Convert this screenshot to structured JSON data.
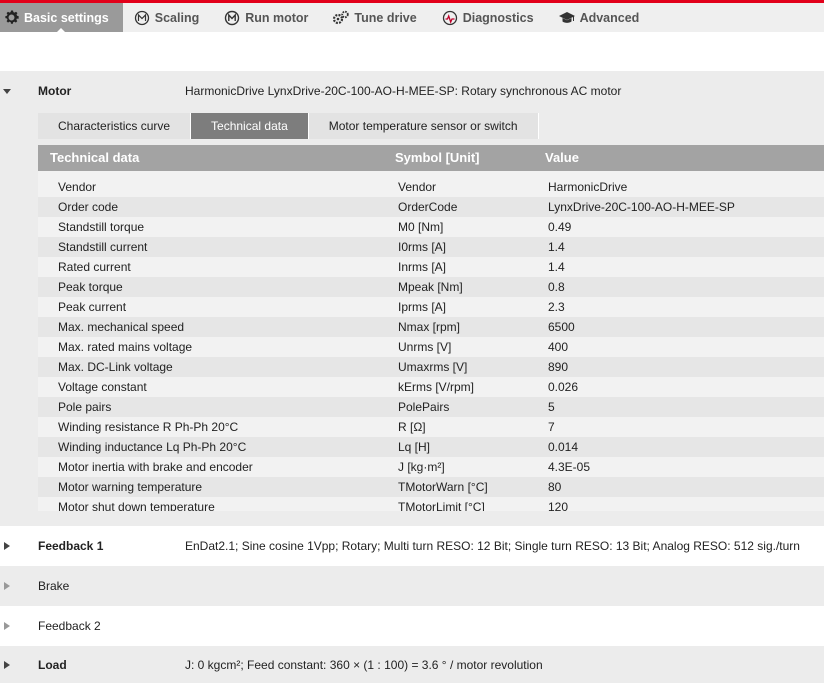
{
  "nav": {
    "tabs": [
      {
        "label": "Basic settings",
        "icon": "gear-icon"
      },
      {
        "label": "Scaling",
        "icon": "scaling-icon"
      },
      {
        "label": "Run motor",
        "icon": "motor-icon"
      },
      {
        "label": "Tune drive",
        "icon": "gears-icon"
      },
      {
        "label": "Diagnostics",
        "icon": "diagnostics-icon"
      },
      {
        "label": "Advanced",
        "icon": "graduation-cap-icon"
      }
    ]
  },
  "motor": {
    "name": "Motor",
    "description": "HarmonicDrive LynxDrive-20C-100-AO-H-MEE-SP: Rotary synchronous AC motor",
    "subtabs": [
      "Characteristics curve",
      "Technical data",
      "Motor temperature sensor or switch"
    ],
    "table": {
      "headers": [
        "Technical data",
        "Symbol [Unit]",
        "Value"
      ],
      "rows": [
        [
          "Vendor",
          "Vendor",
          "HarmonicDrive"
        ],
        [
          "Order code",
          "OrderCode",
          "LynxDrive-20C-100-AO-H-MEE-SP"
        ],
        [
          "Standstill torque",
          "M0 [Nm]",
          "0.49"
        ],
        [
          "Standstill current",
          "I0rms [A]",
          "1.4"
        ],
        [
          "Rated current",
          "Inrms [A]",
          "1.4"
        ],
        [
          "Peak torque",
          "Mpeak [Nm]",
          "0.8"
        ],
        [
          "Peak current",
          "Iprms [A]",
          "2.3"
        ],
        [
          "Max. mechanical speed",
          "Nmax [rpm]",
          "6500"
        ],
        [
          "Max. rated mains voltage",
          "Unrms [V]",
          "400"
        ],
        [
          "Max. DC-Link voltage",
          "Umaxrms [V]",
          "890"
        ],
        [
          "Voltage constant",
          "kErms [V/rpm]",
          "0.026"
        ],
        [
          "Pole pairs",
          "PolePairs",
          "5"
        ],
        [
          "Winding resistance R Ph-Ph 20°C",
          "R [Ω]",
          "7"
        ],
        [
          "Winding inductance Lq Ph-Ph 20°C",
          "Lq [H]",
          "0.014"
        ],
        [
          "Motor inertia with brake and encoder",
          "J [kg·m²]",
          "4.3E-05"
        ],
        [
          "Motor warning temperature",
          "TMotorWarn [°C]",
          "80"
        ],
        [
          "Motor shut down temperature",
          "TMotorLimit [°C]",
          "120"
        ]
      ]
    }
  },
  "feedback1": {
    "name": "Feedback 1",
    "description": "EnDat2.1; Sine cosine 1Vpp; Rotary; Multi turn RESO: 12 Bit; Single turn RESO: 13 Bit; Analog RESO: 512 sig./turn"
  },
  "brake": {
    "name": "Brake"
  },
  "feedback2": {
    "name": "Feedback 2"
  },
  "load": {
    "name": "Load",
    "description": "J: 0 kgcm²; Feed constant: 360 × (1 : 100)  = 3.6 ° / motor revolution"
  },
  "colors": {
    "accent": "#e2001a",
    "active_tab": "#9a9a9a",
    "table_header": "#a3a3a3"
  }
}
